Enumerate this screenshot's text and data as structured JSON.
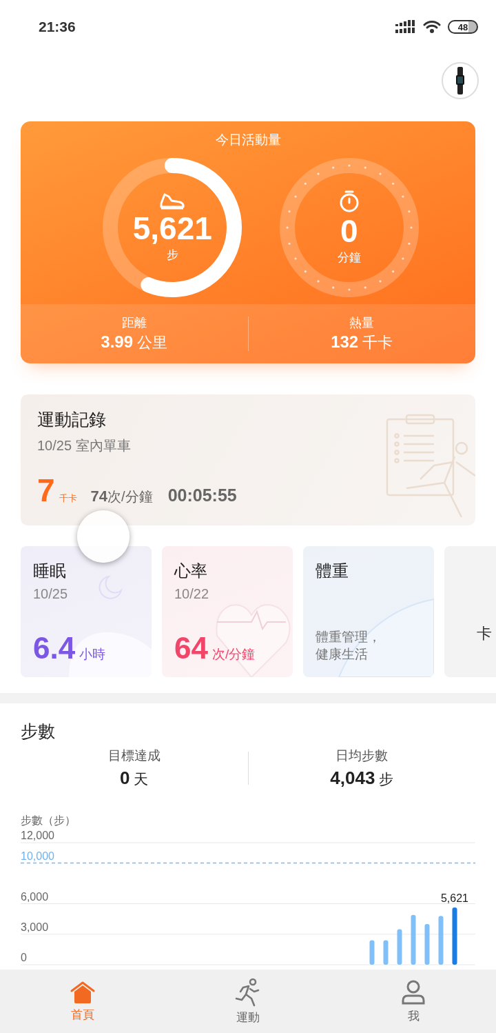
{
  "status_bar": {
    "time": "21:36",
    "battery": "48"
  },
  "activity": {
    "title": "今日活動量",
    "rings": [
      {
        "kind": "steps",
        "value": "5,621",
        "unit": "步",
        "level": 0.5621
      },
      {
        "kind": "minutes",
        "value": "0",
        "unit": "分鐘",
        "level": 0
      }
    ],
    "stats": [
      {
        "label": "距離",
        "value": "3.99",
        "unit": "公里"
      },
      {
        "label": "熱量",
        "value": "132",
        "unit": "千卡"
      }
    ]
  },
  "exercise_record": {
    "title": "運動記錄",
    "date": "10/25",
    "activity": "室內單車",
    "calories": "7",
    "calories_unit": "千卡",
    "heart_rate": "74",
    "heart_rate_unit": "次/分鐘",
    "duration": "00:05:55"
  },
  "cards": [
    {
      "kind": "sleep",
      "title": "睡眠",
      "date": "10/25",
      "value": "6.4",
      "unit": "小時",
      "color": "#7b57e4"
    },
    {
      "kind": "heart",
      "title": "心率",
      "date": "10/22",
      "value": "64",
      "unit": "次/分鐘",
      "color": "#f2456a"
    },
    {
      "kind": "weight",
      "title": "體重",
      "text": "體重管理，健康生活"
    },
    {
      "kind": "partial",
      "text": "卡"
    }
  ],
  "steps": {
    "title": "步數",
    "stats": [
      {
        "label": "目標達成",
        "value": "0",
        "unit": "天"
      },
      {
        "label": "日均步數",
        "value": "4,043",
        "unit": "步"
      }
    ],
    "chart_data": {
      "type": "bar",
      "ylabel": "步數（步）",
      "ylim": [
        0,
        12000
      ],
      "yticks": [
        {
          "value": 0,
          "label": "0"
        },
        {
          "value": 3000,
          "label": "3,000"
        },
        {
          "value": 6000,
          "label": "6,000"
        },
        {
          "value": 10000,
          "label": "10,000"
        },
        {
          "value": 12000,
          "label": "12,000"
        }
      ],
      "series": [
        {
          "color": "#80bff8",
          "values": [
            null,
            null,
            null,
            null,
            null,
            null,
            null,
            null,
            null,
            null,
            null,
            null,
            null,
            null,
            null,
            null,
            null,
            null,
            null,
            null,
            null,
            null,
            null,
            null,
            null,
            2400,
            2400,
            3500,
            4900,
            4000,
            4800,
            null,
            null
          ]
        },
        {
          "color": "#1a7de6",
          "values": [
            null,
            null,
            null,
            null,
            null,
            null,
            null,
            null,
            null,
            null,
            null,
            null,
            null,
            null,
            null,
            null,
            null,
            null,
            null,
            null,
            null,
            null,
            null,
            null,
            null,
            null,
            null,
            null,
            null,
            null,
            null,
            5621,
            null
          ]
        }
      ],
      "ref_lines": [
        {
          "axis": "y",
          "value": 10000
        }
      ],
      "annotations": [
        "5,621"
      ]
    }
  },
  "nav": [
    {
      "kind": "home",
      "label": "首頁",
      "selected": true
    },
    {
      "kind": "run",
      "label": "運動",
      "selected": false
    },
    {
      "kind": "profile",
      "label": "我",
      "selected": false
    }
  ]
}
